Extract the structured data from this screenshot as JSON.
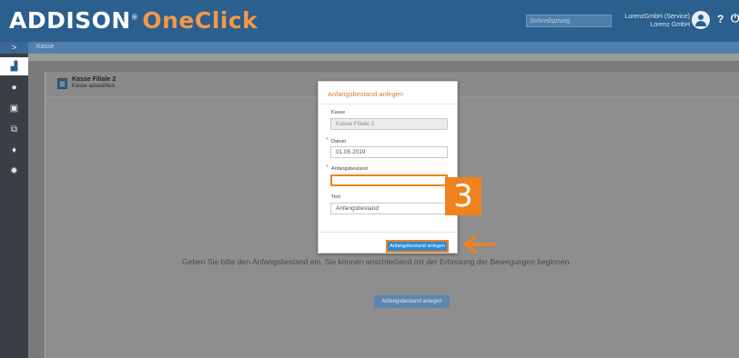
{
  "header": {
    "logo_part1": "ADDISON",
    "logo_reg": "®",
    "logo_part2": "OneClick",
    "jump_placeholder": "Schnellsprung",
    "user_line1": "LorenzGmbH (Service)",
    "user_line2": "Lorenz GmbH",
    "help_label": "?",
    "power_label": "⏻"
  },
  "breadcrumb": {
    "toggle": ">",
    "current": "Kasse"
  },
  "sidebar": {
    "items": [
      {
        "icon": "chart-icon",
        "glyph": "▟"
      },
      {
        "icon": "chat-icon",
        "glyph": "●"
      },
      {
        "icon": "document-icon",
        "glyph": "▣"
      },
      {
        "icon": "copy-icon",
        "glyph": "⧉"
      },
      {
        "icon": "user-settings-icon",
        "glyph": "♦"
      },
      {
        "icon": "gear-icon",
        "glyph": "✹"
      }
    ]
  },
  "panel": {
    "title": "Kasse Filiale 2",
    "subtitle": "Kasse auswählen",
    "empty_message": "Geben Sie bitte den Anfangsbestand ein. Sie können anschließend mit der Erfassung der Bewegungen beginnen.",
    "create_button": "Anfangsbestand anlegen"
  },
  "modal": {
    "title": "Anfangsbestand anlegen",
    "fields": {
      "kasse_label": "Kasse",
      "kasse_value": "Kasse Filiale 2",
      "datum_label": "Datum",
      "datum_value": "01.05.2019",
      "anfangsbestand_label": "Anfangsbestand",
      "anfangsbestand_value": "",
      "text_label": "Text",
      "text_value": "Anfangsbestand"
    },
    "required_mark": "*",
    "submit_label": "Anfangsbestand anlegen"
  },
  "annotation": {
    "step_number": "3"
  },
  "colors": {
    "header_blue": "#2a5f8e",
    "accent_orange": "#f0821e",
    "button_blue": "#2d8bd3"
  }
}
